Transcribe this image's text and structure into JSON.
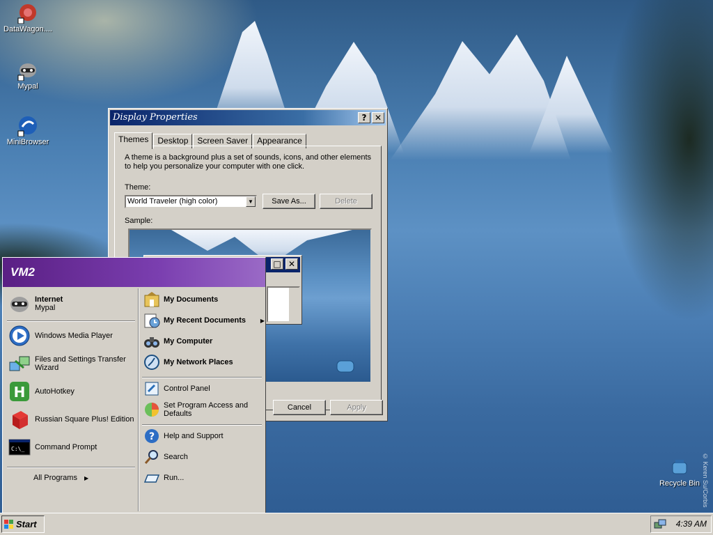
{
  "desktop": {
    "icons": [
      {
        "label": "DataWagon....",
        "icon": "datawagon-icon"
      },
      {
        "label": "Mypal",
        "icon": "mypal-raccoon-icon"
      },
      {
        "label": "MiniBrowser",
        "icon": "minibrowser-icon"
      }
    ],
    "recycle_bin": {
      "label": "Recycle Bin",
      "icon": "recycle-bin-icon"
    },
    "watermark": "© Keren Su/Corbis"
  },
  "display_properties": {
    "title": "Display Properties",
    "help_label": "?",
    "close_label": "✕",
    "tabs": [
      "Themes",
      "Desktop",
      "Screen Saver",
      "Appearance"
    ],
    "active_tab": "Themes",
    "description": "A theme is a background plus a set of sounds, icons, and other elements to help you personalize your computer with one click.",
    "theme_label": "Theme:",
    "theme_value": "World Traveler (high color)",
    "save_as_label": "Save As...",
    "delete_label": "Delete",
    "sample_label": "Sample:",
    "cancel_label": "Cancel",
    "apply_label": "Apply"
  },
  "start_menu": {
    "user": "VM2",
    "pinned": [
      {
        "title": "Internet",
        "subtitle": "Mypal",
        "icon": "mypal-raccoon-icon"
      }
    ],
    "recent_programs": [
      {
        "label": "Windows Media Player",
        "icon": "media-player-icon"
      },
      {
        "label": "Files and Settings Transfer",
        "label2": "Wizard",
        "icon": "transfer-wizard-icon"
      },
      {
        "label": "AutoHotkey",
        "icon": "autohotkey-icon"
      },
      {
        "label": "Russian Square Plus! Edition",
        "icon": "cube-icon"
      },
      {
        "label": "Command Prompt",
        "icon": "command-prompt-icon"
      }
    ],
    "all_programs": "All Programs",
    "right_items": [
      {
        "label": "My Documents",
        "icon": "my-documents-icon"
      },
      {
        "label": "My Recent Documents",
        "icon": "recent-documents-icon"
      },
      {
        "label": "My Computer",
        "icon": "my-computer-icon"
      },
      {
        "label": "My Network Places",
        "icon": "network-places-icon"
      }
    ],
    "right_items_2": [
      {
        "label": "Control Panel",
        "icon": "control-panel-icon"
      },
      {
        "label": "Set Program Access and",
        "label2": "Defaults",
        "icon": "program-access-icon"
      }
    ],
    "right_items_3": [
      {
        "label": "Help and Support",
        "icon": "help-icon"
      },
      {
        "label": "Search",
        "icon": "search-icon"
      },
      {
        "label": "Run...",
        "icon": "run-icon"
      }
    ]
  },
  "taskbar": {
    "start_label": "Start",
    "clock": "4:39 AM"
  },
  "colors": {
    "title_start": "#0a246a",
    "title_end": "#a6caf0",
    "start_menu_header": "#5a1f84",
    "face": "#d4d0c8"
  }
}
